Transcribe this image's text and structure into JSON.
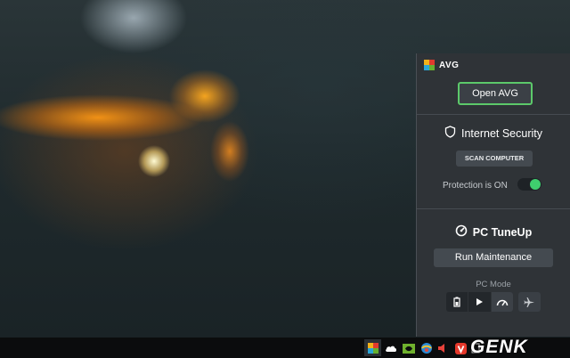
{
  "avg_panel": {
    "brand": "AVG",
    "open_button": "Open AVG",
    "internet_security": {
      "title": "Internet Security",
      "scan_button": "SCAN COMPUTER",
      "protection_label": "Protection is ON",
      "protection_on": true
    },
    "pc_tuneup": {
      "title": "PC TuneUp",
      "run_button": "Run Maintenance",
      "mode_label": "PC Mode",
      "modes": [
        "economy-mode",
        "standard-mode",
        "turbo-mode",
        "airplane-mode"
      ],
      "active_mode": "turbo-mode"
    }
  },
  "taskbar": {
    "tray_icons": [
      "avg-tray-icon",
      "onedrive-icon",
      "nvidia-icon",
      "network-icon",
      "volume-icon",
      "vivaldi-icon",
      "input-method-icon"
    ]
  },
  "watermark": "GENK",
  "colors": {
    "panel_bg": "#2f3337",
    "accent_green": "#5cc96a",
    "toggle_on": "#3fce6e"
  }
}
